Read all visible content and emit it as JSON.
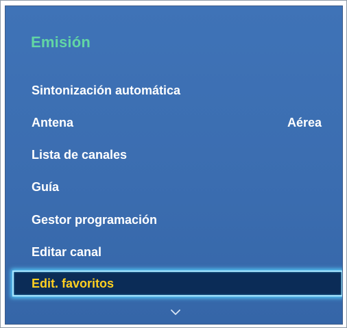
{
  "panel": {
    "title": "Emisión"
  },
  "menu": {
    "items": [
      {
        "label": "Sintonización automática",
        "value": ""
      },
      {
        "label": "Antena",
        "value": "Aérea"
      },
      {
        "label": "Lista de canales",
        "value": ""
      },
      {
        "label": "Guía",
        "value": ""
      },
      {
        "label": "Gestor programación",
        "value": ""
      },
      {
        "label": "Editar canal",
        "value": ""
      },
      {
        "label": "Edit. favoritos",
        "value": ""
      }
    ],
    "selected_index": 6,
    "more_icon": "chevron-down-icon"
  },
  "colors": {
    "panel_background": "#3b6db0",
    "title": "#62d6a4",
    "item_text": "#ffffff",
    "selected_background": "#0b2c57",
    "selected_text": "#ffd020",
    "selected_glow": "#5ad2ff"
  }
}
